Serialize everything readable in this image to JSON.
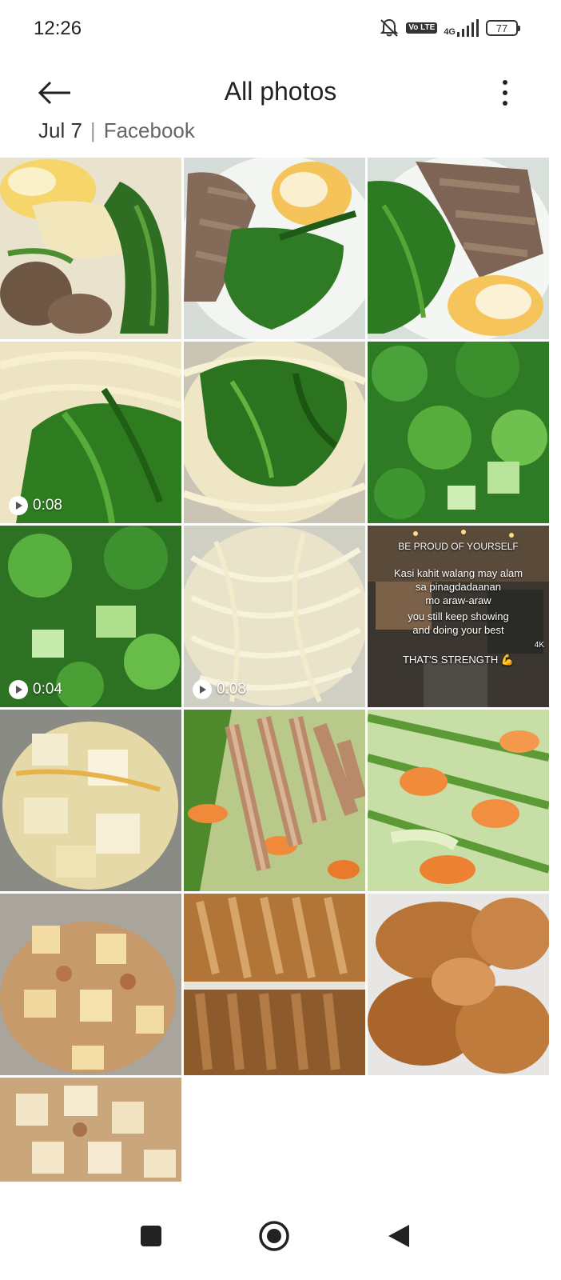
{
  "status_bar": {
    "time": "12:26",
    "volte": "Vo LTE",
    "network": "4G",
    "battery": "77"
  },
  "header": {
    "title": "All photos",
    "back_icon": "arrow-left-icon",
    "more_icon": "more-vertical-icon"
  },
  "section": {
    "date": "Jul 7",
    "source": "Facebook"
  },
  "tiles": [
    {
      "type": "photo"
    },
    {
      "type": "photo"
    },
    {
      "type": "photo"
    },
    {
      "type": "video",
      "duration": "0:08"
    },
    {
      "type": "photo"
    },
    {
      "type": "photo"
    },
    {
      "type": "video",
      "duration": "0:04"
    },
    {
      "type": "video",
      "duration": "0:08"
    },
    {
      "type": "photo",
      "quote": {
        "line1": "BE PROUD OF YOURSELF",
        "line2": "Kasi kahit walang may alam",
        "line3": "sa pinagdadaanan",
        "line4": "mo araw-araw",
        "line5": "you still keep showing",
        "line6": "and doing your best",
        "line7": "THAT'S STRENGTH 💪",
        "count": "4K"
      }
    },
    {
      "type": "photo"
    },
    {
      "type": "photo"
    },
    {
      "type": "photo"
    },
    {
      "type": "photo"
    },
    {
      "type": "photo"
    },
    {
      "type": "photo"
    },
    {
      "type": "photo"
    }
  ],
  "nav": {
    "recents_icon": "square-icon",
    "home_icon": "circle-home-icon",
    "back_icon": "triangle-back-icon"
  },
  "colors": {
    "text": "#222222",
    "background": "#ffffff"
  }
}
